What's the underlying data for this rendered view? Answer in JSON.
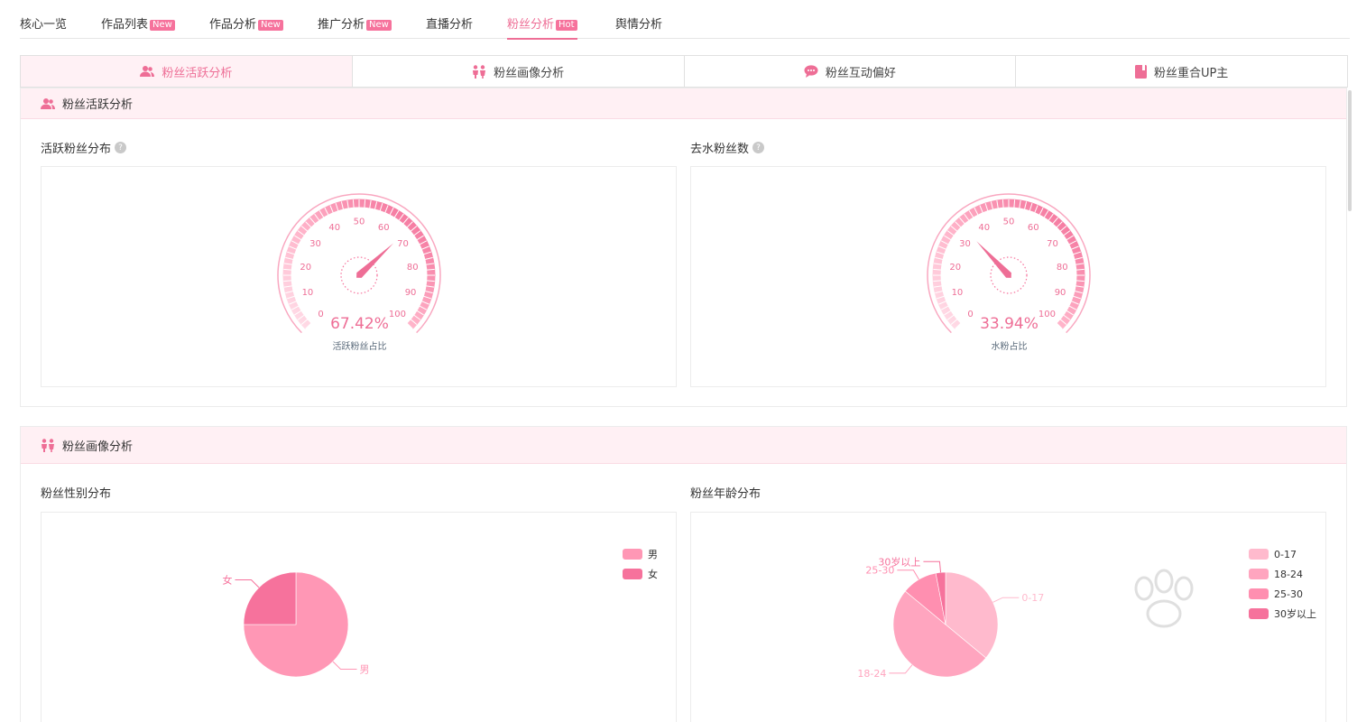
{
  "nav": {
    "items": [
      {
        "label": "核心一览",
        "badge": ""
      },
      {
        "label": "作品列表",
        "badge": "New"
      },
      {
        "label": "作品分析",
        "badge": "New"
      },
      {
        "label": "推广分析",
        "badge": "New"
      },
      {
        "label": "直播分析",
        "badge": ""
      },
      {
        "label": "粉丝分析",
        "badge": "Hot"
      },
      {
        "label": "舆情分析",
        "badge": ""
      }
    ],
    "active_index": 5
  },
  "subtabs": [
    {
      "label": "粉丝活跃分析",
      "icon": "users-icon"
    },
    {
      "label": "粉丝画像分析",
      "icon": "couple-icon"
    },
    {
      "label": "粉丝互动偏好",
      "icon": "chat-icon"
    },
    {
      "label": "粉丝重合UP主",
      "icon": "book-icon"
    }
  ],
  "section_activity": {
    "title": "粉丝活跃分析",
    "active_card": {
      "title": "活跃粉丝分布",
      "value_text": "67.42%",
      "caption": "活跃粉丝占比"
    },
    "water_card": {
      "title": "去水粉丝数",
      "value_text": "33.94%",
      "caption": "水粉占比"
    }
  },
  "section_profile": {
    "title": "粉丝画像分析",
    "gender_card": {
      "title": "粉丝性别分布"
    },
    "age_card": {
      "title": "粉丝年龄分布"
    }
  },
  "colors": {
    "accent": "#ee6e96",
    "pink_light": "#ffb8cc",
    "pink_mid": "#ff9cb8",
    "pink_dark": "#f6729c"
  },
  "chart_data": [
    {
      "type": "gauge",
      "title": "",
      "value": 67.42,
      "range": [
        0,
        100
      ],
      "ticks": [
        0,
        10,
        20,
        30,
        40,
        50,
        60,
        70,
        80,
        90,
        100
      ],
      "label": "67.42%",
      "caption": "活跃粉丝占比"
    },
    {
      "type": "gauge",
      "title": "",
      "value": 33.94,
      "range": [
        0,
        100
      ],
      "ticks": [
        0,
        10,
        20,
        30,
        40,
        50,
        60,
        70,
        80,
        90,
        100
      ],
      "label": "33.94%",
      "caption": "水粉占比"
    },
    {
      "type": "pie",
      "categories": [
        "男",
        "女"
      ],
      "values": [
        75,
        25
      ],
      "colors": [
        "#ff97b5",
        "#f6729c"
      ],
      "legend": "top-right"
    },
    {
      "type": "pie",
      "categories": [
        "0-17",
        "18-24",
        "25-30",
        "30岁以上"
      ],
      "values": [
        36,
        50,
        11,
        3
      ],
      "colors": [
        "#ffbacd",
        "#ffa5bf",
        "#ff8fb0",
        "#f6729c"
      ],
      "legend": "top-right"
    }
  ]
}
